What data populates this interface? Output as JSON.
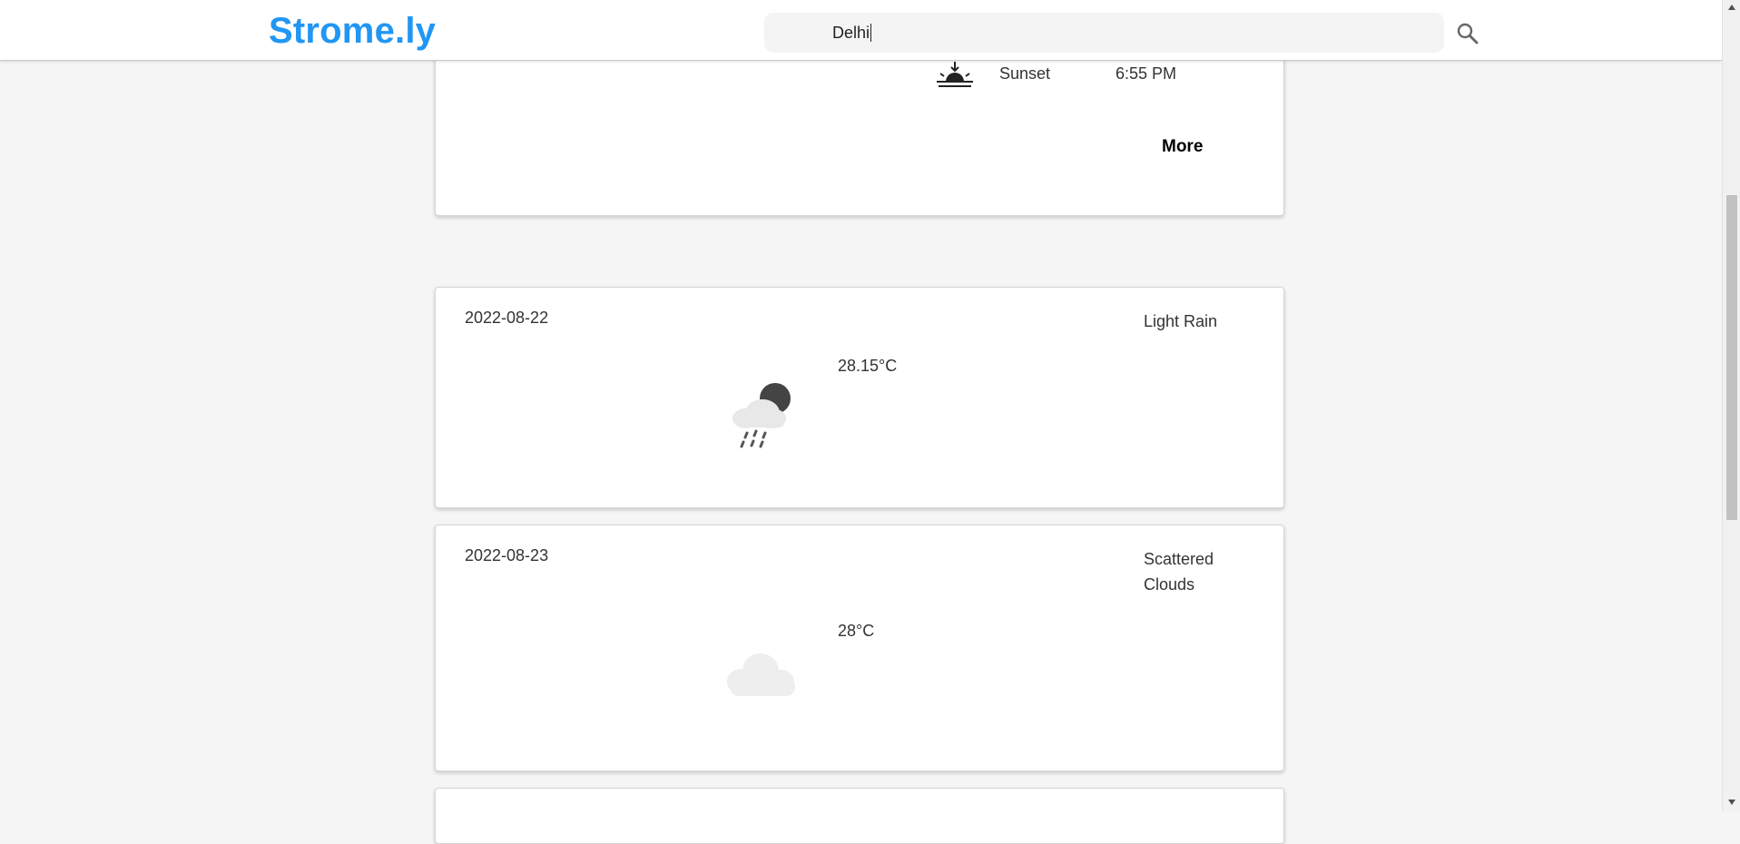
{
  "header": {
    "logo": "Strome.ly",
    "search": {
      "value": "Delhi",
      "icon": "search-icon"
    }
  },
  "today": {
    "sunset_label": "Sunset",
    "sunset_time": "6:55 PM",
    "sunset_icon": "sunset-icon",
    "more_label": "More"
  },
  "forecast": [
    {
      "date": "2022-08-22",
      "condition": "Light Rain",
      "temperature": "28.15°C",
      "icon": "rain-night-icon"
    },
    {
      "date": "2022-08-23",
      "condition": "Scattered Clouds",
      "temperature": "28°C",
      "icon": "cloud-icon"
    }
  ],
  "colors": {
    "brand": "#2196f3",
    "background": "#f5f5f5",
    "card": "#ffffff"
  }
}
